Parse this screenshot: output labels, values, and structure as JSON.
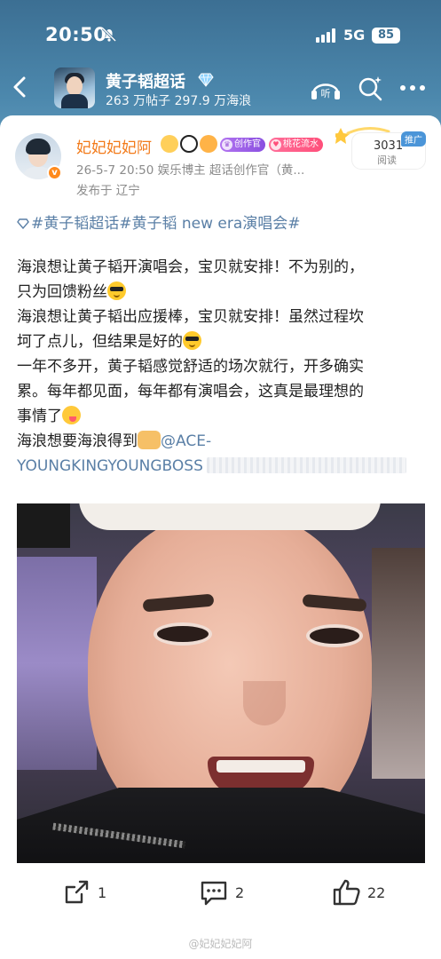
{
  "status_bar": {
    "time": "20:50",
    "network": "5G",
    "battery": "85"
  },
  "nav": {
    "topic_title": "黄子韬超话",
    "topic_stats": "263 万帖子  297.9 万海浪",
    "icons": [
      "back-icon",
      "listen-icon",
      "search-icon",
      "more-icon"
    ]
  },
  "post": {
    "author_name": "妃妃妃妃阿",
    "author_tags": [
      "创作官",
      "桃花流水"
    ],
    "meta": "26-5-7 20:50   娱乐博主 超话创作官（黄...",
    "location": "发布于 辽宁",
    "read_count": "3031",
    "read_label": "阅读",
    "promo_label": "推广",
    "hashtags": "#黄子韬超话#黄子韬 new era演唱会#",
    "lines": [
      "海浪想让黄子韬开演唱会，宝贝就安排！不为别的，",
      "只为回馈粉丝",
      "海浪想让黄子韬出应援棒，宝贝就安排！虽然过程坎",
      "坷了点儿，但结果是好的",
      "一年不多开，黄子韬感觉舒适的场次就行，开多确实",
      "累。每年都见面，每年都有演唱会，这真是最理想的",
      "事情了",
      "海浪想要海浪得到",
      "YOUNGKINGYOUNGBOSS"
    ],
    "mention": "@ACE-"
  },
  "actions": {
    "share_count": "1",
    "comment_count": "2",
    "like_count": "22"
  },
  "watermark": "@妃妃妃妃阿",
  "colors": {
    "header_blue": "#4c88ad",
    "author_orange": "#f27a1a",
    "link_blue": "#5a7fa6"
  }
}
